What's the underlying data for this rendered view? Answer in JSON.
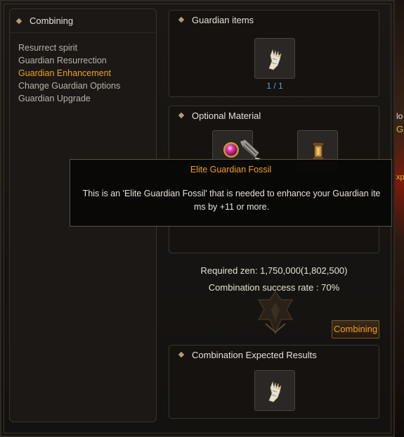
{
  "left_panel": {
    "title": "Combining",
    "menu": [
      {
        "label": "Resurrect spirit",
        "active": false
      },
      {
        "label": "Guardian Resurrection",
        "active": false
      },
      {
        "label": "Guardian Enhancement",
        "active": true
      },
      {
        "label": "Change Guardian Options",
        "active": false
      },
      {
        "label": "Guardian Upgrade",
        "active": false
      }
    ]
  },
  "guardian_items": {
    "title": "Guardian items",
    "count": "1 / 1",
    "icon": "guardian-claw-icon"
  },
  "optional_material": {
    "title": "Optional Material",
    "slot1_icon": "elite-guardian-fossil-icon",
    "slot2_icon": "lantern-icon"
  },
  "tooltip": {
    "title": "Elite Guardian Fossil",
    "body_line1": "This is an 'Elite Guardian Fossil' that is needed to enhance your Guardian ite",
    "body_line2": "ms by +11 or more."
  },
  "required_zen": "Required zen: 1,750,000(1,802,500)",
  "success_rate": "Combination success rate : 70%",
  "combine_button": "Combining",
  "expected_results": {
    "title": "Combination Expected Results",
    "icon": "guardian-claw-icon"
  },
  "edge_texts": {
    "text1": "lo",
    "text2": "G",
    "text3": "xp"
  },
  "colors": {
    "accent": "#f0a020",
    "count_blue": "#5aa0e8",
    "panel_bg": "#1b1815"
  }
}
